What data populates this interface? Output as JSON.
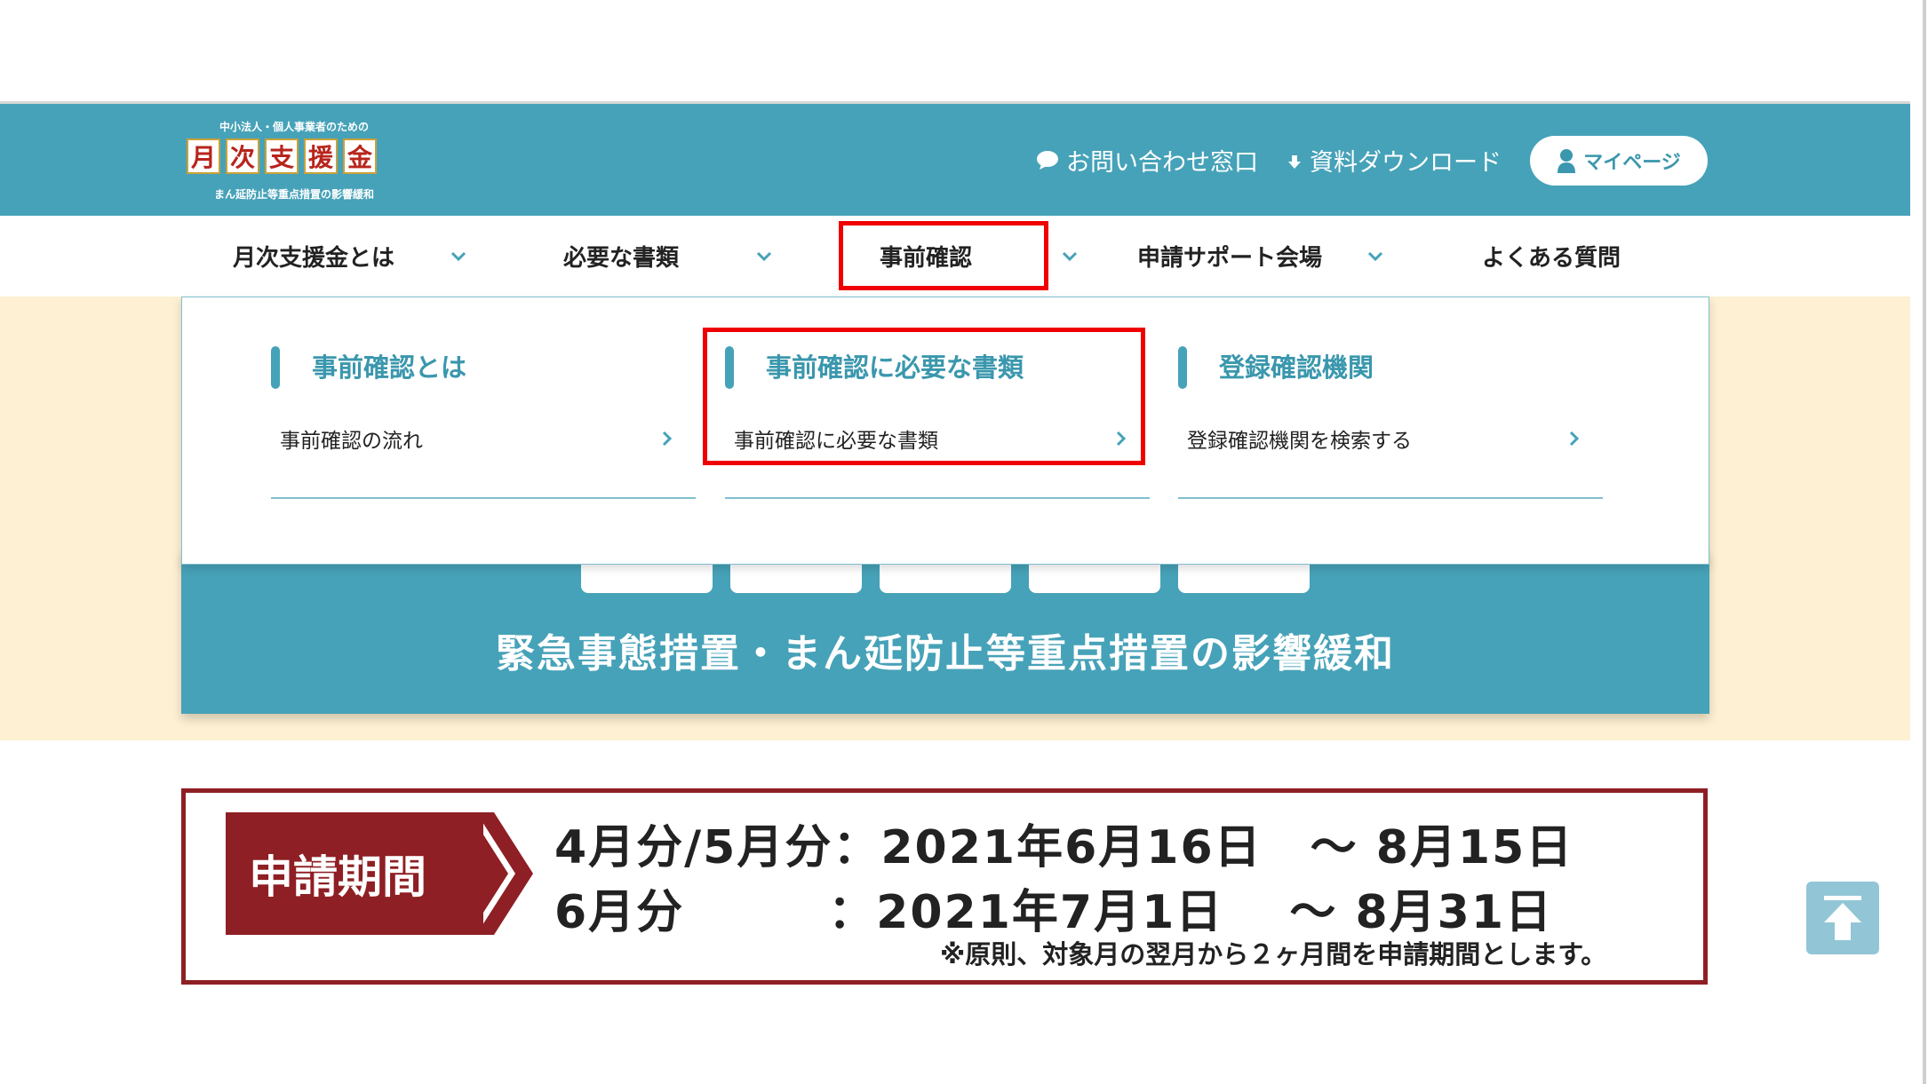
{
  "logo": {
    "tagline_top": "中小法人・個人事業者のための",
    "chars": [
      "月",
      "次",
      "支",
      "援",
      "金"
    ],
    "tagline_bottom": "まん延防止等重点措置の影響緩和"
  },
  "header": {
    "contact_label": "お問い合わせ窓口",
    "download_label": "資料ダウンロード",
    "mypage_label": "マイページ"
  },
  "nav": {
    "items": [
      {
        "label": "月次支援金とは",
        "has_dropdown": true
      },
      {
        "label": "必要な書類",
        "has_dropdown": true
      },
      {
        "label": "事前確認",
        "has_dropdown": true
      },
      {
        "label": "申請サポート会場",
        "has_dropdown": true
      },
      {
        "label": "よくある質問",
        "has_dropdown": false
      }
    ]
  },
  "dropdown": {
    "columns": [
      {
        "title": "事前確認とは",
        "link": "事前確認の流れ"
      },
      {
        "title": "事前確認に必要な書類",
        "link": "事前確認に必要な書類"
      },
      {
        "title": "登録確認機関",
        "link": "登録確認機関を検索する"
      }
    ]
  },
  "hero": {
    "text": "緊急事態措置・まん延防止等重点措置の影響緩和"
  },
  "period": {
    "label": "申請期間",
    "row1": "4月分/5月分：2021年6月16日　～ 8月15日",
    "row2": "6月分　　　：2021年7月1日　 ～ 8月31日",
    "note": "※原則、対象月の翌月から２ヶ月間を申請期間とします。"
  },
  "colors": {
    "teal": "#46a2b8",
    "cream": "#fdf0d3",
    "maroon": "#8e1f24",
    "highlight": "#f00000"
  }
}
